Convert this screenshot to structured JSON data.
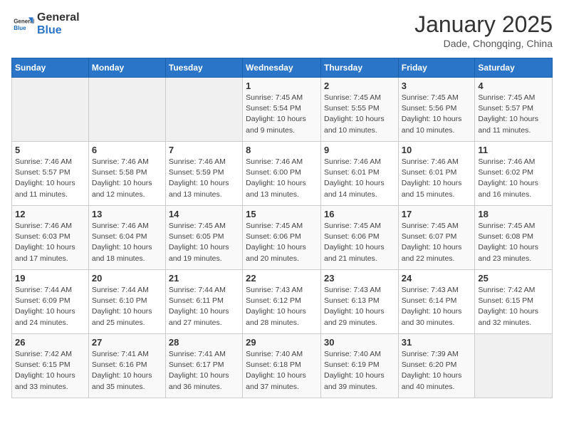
{
  "header": {
    "logo_line1": "General",
    "logo_line2": "Blue",
    "month": "January 2025",
    "location": "Dade, Chongqing, China"
  },
  "weekdays": [
    "Sunday",
    "Monday",
    "Tuesday",
    "Wednesday",
    "Thursday",
    "Friday",
    "Saturday"
  ],
  "weeks": [
    [
      {
        "day": "",
        "info": ""
      },
      {
        "day": "",
        "info": ""
      },
      {
        "day": "",
        "info": ""
      },
      {
        "day": "1",
        "info": "Sunrise: 7:45 AM\nSunset: 5:54 PM\nDaylight: 10 hours and 9 minutes."
      },
      {
        "day": "2",
        "info": "Sunrise: 7:45 AM\nSunset: 5:55 PM\nDaylight: 10 hours and 10 minutes."
      },
      {
        "day": "3",
        "info": "Sunrise: 7:45 AM\nSunset: 5:56 PM\nDaylight: 10 hours and 10 minutes."
      },
      {
        "day": "4",
        "info": "Sunrise: 7:45 AM\nSunset: 5:57 PM\nDaylight: 10 hours and 11 minutes."
      }
    ],
    [
      {
        "day": "5",
        "info": "Sunrise: 7:46 AM\nSunset: 5:57 PM\nDaylight: 10 hours and 11 minutes."
      },
      {
        "day": "6",
        "info": "Sunrise: 7:46 AM\nSunset: 5:58 PM\nDaylight: 10 hours and 12 minutes."
      },
      {
        "day": "7",
        "info": "Sunrise: 7:46 AM\nSunset: 5:59 PM\nDaylight: 10 hours and 13 minutes."
      },
      {
        "day": "8",
        "info": "Sunrise: 7:46 AM\nSunset: 6:00 PM\nDaylight: 10 hours and 13 minutes."
      },
      {
        "day": "9",
        "info": "Sunrise: 7:46 AM\nSunset: 6:01 PM\nDaylight: 10 hours and 14 minutes."
      },
      {
        "day": "10",
        "info": "Sunrise: 7:46 AM\nSunset: 6:01 PM\nDaylight: 10 hours and 15 minutes."
      },
      {
        "day": "11",
        "info": "Sunrise: 7:46 AM\nSunset: 6:02 PM\nDaylight: 10 hours and 16 minutes."
      }
    ],
    [
      {
        "day": "12",
        "info": "Sunrise: 7:46 AM\nSunset: 6:03 PM\nDaylight: 10 hours and 17 minutes."
      },
      {
        "day": "13",
        "info": "Sunrise: 7:46 AM\nSunset: 6:04 PM\nDaylight: 10 hours and 18 minutes."
      },
      {
        "day": "14",
        "info": "Sunrise: 7:45 AM\nSunset: 6:05 PM\nDaylight: 10 hours and 19 minutes."
      },
      {
        "day": "15",
        "info": "Sunrise: 7:45 AM\nSunset: 6:06 PM\nDaylight: 10 hours and 20 minutes."
      },
      {
        "day": "16",
        "info": "Sunrise: 7:45 AM\nSunset: 6:06 PM\nDaylight: 10 hours and 21 minutes."
      },
      {
        "day": "17",
        "info": "Sunrise: 7:45 AM\nSunset: 6:07 PM\nDaylight: 10 hours and 22 minutes."
      },
      {
        "day": "18",
        "info": "Sunrise: 7:45 AM\nSunset: 6:08 PM\nDaylight: 10 hours and 23 minutes."
      }
    ],
    [
      {
        "day": "19",
        "info": "Sunrise: 7:44 AM\nSunset: 6:09 PM\nDaylight: 10 hours and 24 minutes."
      },
      {
        "day": "20",
        "info": "Sunrise: 7:44 AM\nSunset: 6:10 PM\nDaylight: 10 hours and 25 minutes."
      },
      {
        "day": "21",
        "info": "Sunrise: 7:44 AM\nSunset: 6:11 PM\nDaylight: 10 hours and 27 minutes."
      },
      {
        "day": "22",
        "info": "Sunrise: 7:43 AM\nSunset: 6:12 PM\nDaylight: 10 hours and 28 minutes."
      },
      {
        "day": "23",
        "info": "Sunrise: 7:43 AM\nSunset: 6:13 PM\nDaylight: 10 hours and 29 minutes."
      },
      {
        "day": "24",
        "info": "Sunrise: 7:43 AM\nSunset: 6:14 PM\nDaylight: 10 hours and 30 minutes."
      },
      {
        "day": "25",
        "info": "Sunrise: 7:42 AM\nSunset: 6:15 PM\nDaylight: 10 hours and 32 minutes."
      }
    ],
    [
      {
        "day": "26",
        "info": "Sunrise: 7:42 AM\nSunset: 6:15 PM\nDaylight: 10 hours and 33 minutes."
      },
      {
        "day": "27",
        "info": "Sunrise: 7:41 AM\nSunset: 6:16 PM\nDaylight: 10 hours and 35 minutes."
      },
      {
        "day": "28",
        "info": "Sunrise: 7:41 AM\nSunset: 6:17 PM\nDaylight: 10 hours and 36 minutes."
      },
      {
        "day": "29",
        "info": "Sunrise: 7:40 AM\nSunset: 6:18 PM\nDaylight: 10 hours and 37 minutes."
      },
      {
        "day": "30",
        "info": "Sunrise: 7:40 AM\nSunset: 6:19 PM\nDaylight: 10 hours and 39 minutes."
      },
      {
        "day": "31",
        "info": "Sunrise: 7:39 AM\nSunset: 6:20 PM\nDaylight: 10 hours and 40 minutes."
      },
      {
        "day": "",
        "info": ""
      }
    ]
  ]
}
